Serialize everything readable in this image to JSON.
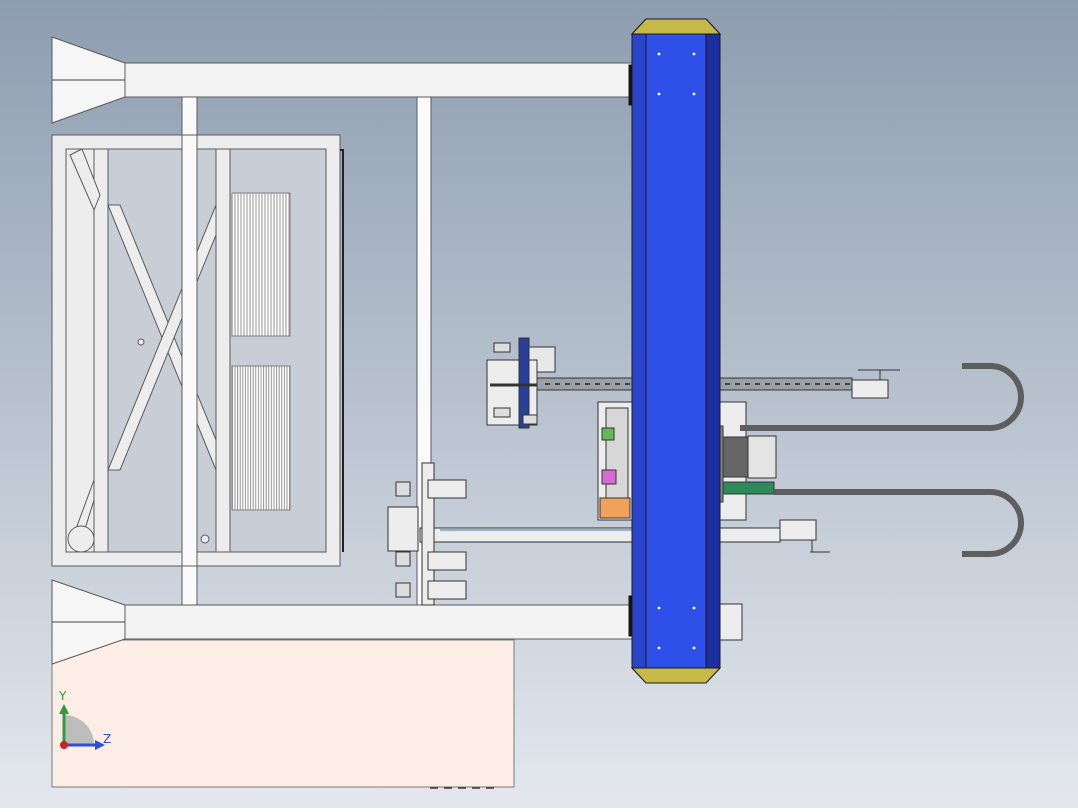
{
  "viewport": {
    "background_top": "#8D9DB0",
    "background_bottom": "#E4E8EE"
  },
  "colors": {
    "frame_fill": "#F1F1F1",
    "frame_stroke": "#5A5A5A",
    "cabinet_fill": "#FCEEE6",
    "column_blue": "#2E4FE8",
    "column_blue_dark": "#1C2FA0",
    "column_cap": "#C7B84A",
    "cable": "#5E5E5E",
    "sheet_lines": "#8A8A8A"
  },
  "triad": {
    "y_label": "Y",
    "z_label": "Z",
    "y_color": "#2E9C3A",
    "z_color": "#2B4FD8",
    "origin_color": "#D22020"
  }
}
